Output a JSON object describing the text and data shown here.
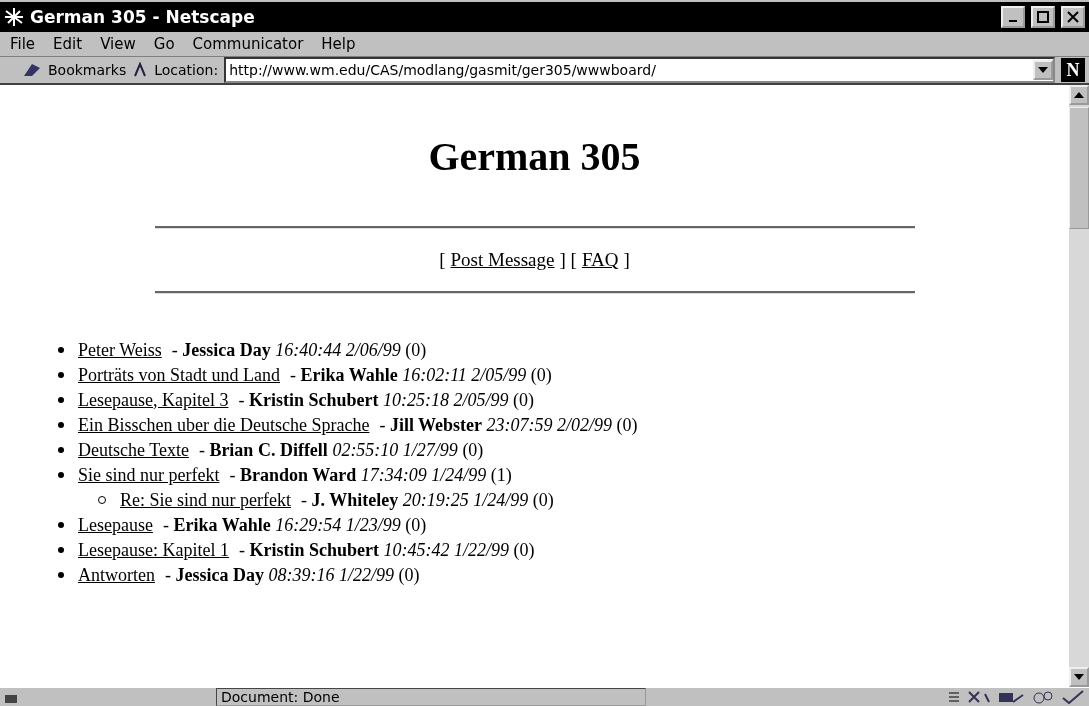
{
  "window": {
    "title": "German 305 - Netscape"
  },
  "menu": [
    "File",
    "Edit",
    "View",
    "Go",
    "Communicator",
    "Help"
  ],
  "location_bar": {
    "bookmarks": "Bookmarks",
    "label": "Location:",
    "url": "http://www.wm.edu/CAS/modlang/gasmit/ger305/wwwboard/",
    "logo": "N"
  },
  "page": {
    "heading": "German 305",
    "nav": [
      {
        "kind": "text",
        "text": "["
      },
      {
        "kind": "link",
        "text": "Post Message"
      },
      {
        "kind": "text",
        "text": "] ["
      },
      {
        "kind": "link",
        "text": "FAQ"
      },
      {
        "kind": "text",
        "text": "]"
      }
    ],
    "messages": [
      {
        "subject": "Peter Weiss",
        "info": "- **Jessica Day** *16:40:44 2/06/99* (0)"
      },
      {
        "subject": "Porträts von Stadt und Land",
        "info": "- **Erika Wahle** *16:02:11 2/05/99* (0)"
      },
      {
        "subject": "Lesepause, Kapitel 3",
        "info": "- **Kristin Schubert** *10:25:18 2/05/99* (0)"
      },
      {
        "subject": "Ein Bisschen uber die Deutsche Sprache",
        "info": "- **Jill Webster** *23:07:59 2/02/99* (0)"
      },
      {
        "subject": "Deutsche Texte",
        "info": "- **Brian C. Diffell** *02:55:10 1/27/99* (0)"
      },
      {
        "subject": "Sie sind nur perfekt",
        "info": "- **Brandon Ward** *17:34:09 1/24/99* (1)",
        "children": [
          {
            "subject": "Re: Sie sind nur perfekt",
            "info": "- **J. Whiteley** *20:19:25 1/24/99* (0)"
          }
        ]
      },
      {
        "subject": "Lesepause",
        "info": "- **Erika Wahle** *16:29:54 1/23/99* (0)"
      },
      {
        "subject": "Lesepause: Kapitel 1",
        "info": "- **Kristin Schubert** *10:45:42 1/22/99* (0)"
      },
      {
        "subject": "Antworten",
        "info": "- **Jessica Day** *08:39:16 1/22/99* (0)"
      }
    ]
  },
  "status_bar": {
    "text": "Document: Done"
  }
}
